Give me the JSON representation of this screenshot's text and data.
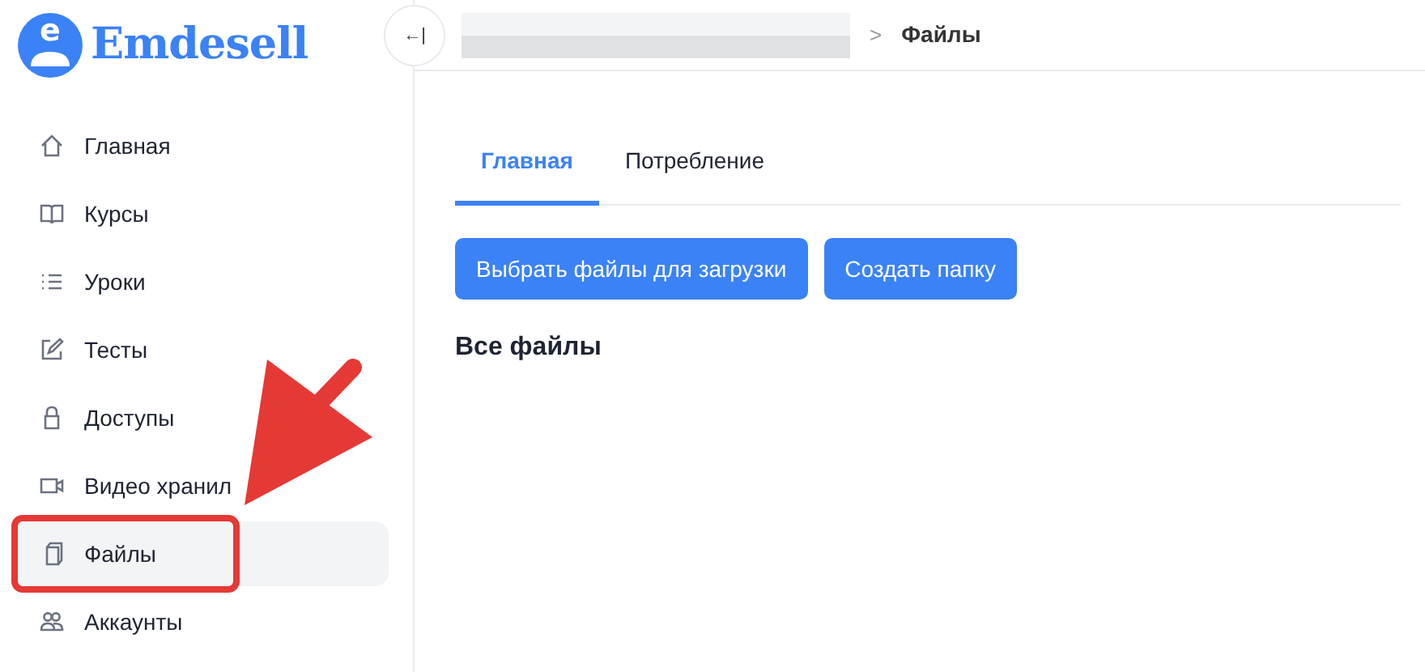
{
  "logo": {
    "mark": "e",
    "name": "Emdesell"
  },
  "sidebar": {
    "items": [
      {
        "label": "Главная",
        "selected": false
      },
      {
        "label": "Курсы",
        "selected": false
      },
      {
        "label": "Уроки",
        "selected": false
      },
      {
        "label": "Тесты",
        "selected": false
      },
      {
        "label": "Доступы",
        "selected": false
      },
      {
        "label": "Видео хранил",
        "selected": false
      },
      {
        "label": "Файлы",
        "selected": true
      },
      {
        "label": "Аккаунты",
        "selected": false
      }
    ]
  },
  "toggle": {
    "glyph": "←|"
  },
  "breadcrumb": {
    "separator": ">",
    "current": "Файлы"
  },
  "tabs": [
    {
      "label": "Главная",
      "selected": true
    },
    {
      "label": "Потребление",
      "selected": false
    }
  ],
  "buttons": [
    "Выбрать файлы для загрузки",
    "Создать папку"
  ],
  "section_title": "Все файлы",
  "annotations": {
    "arrow": true,
    "highlight_box": true
  }
}
